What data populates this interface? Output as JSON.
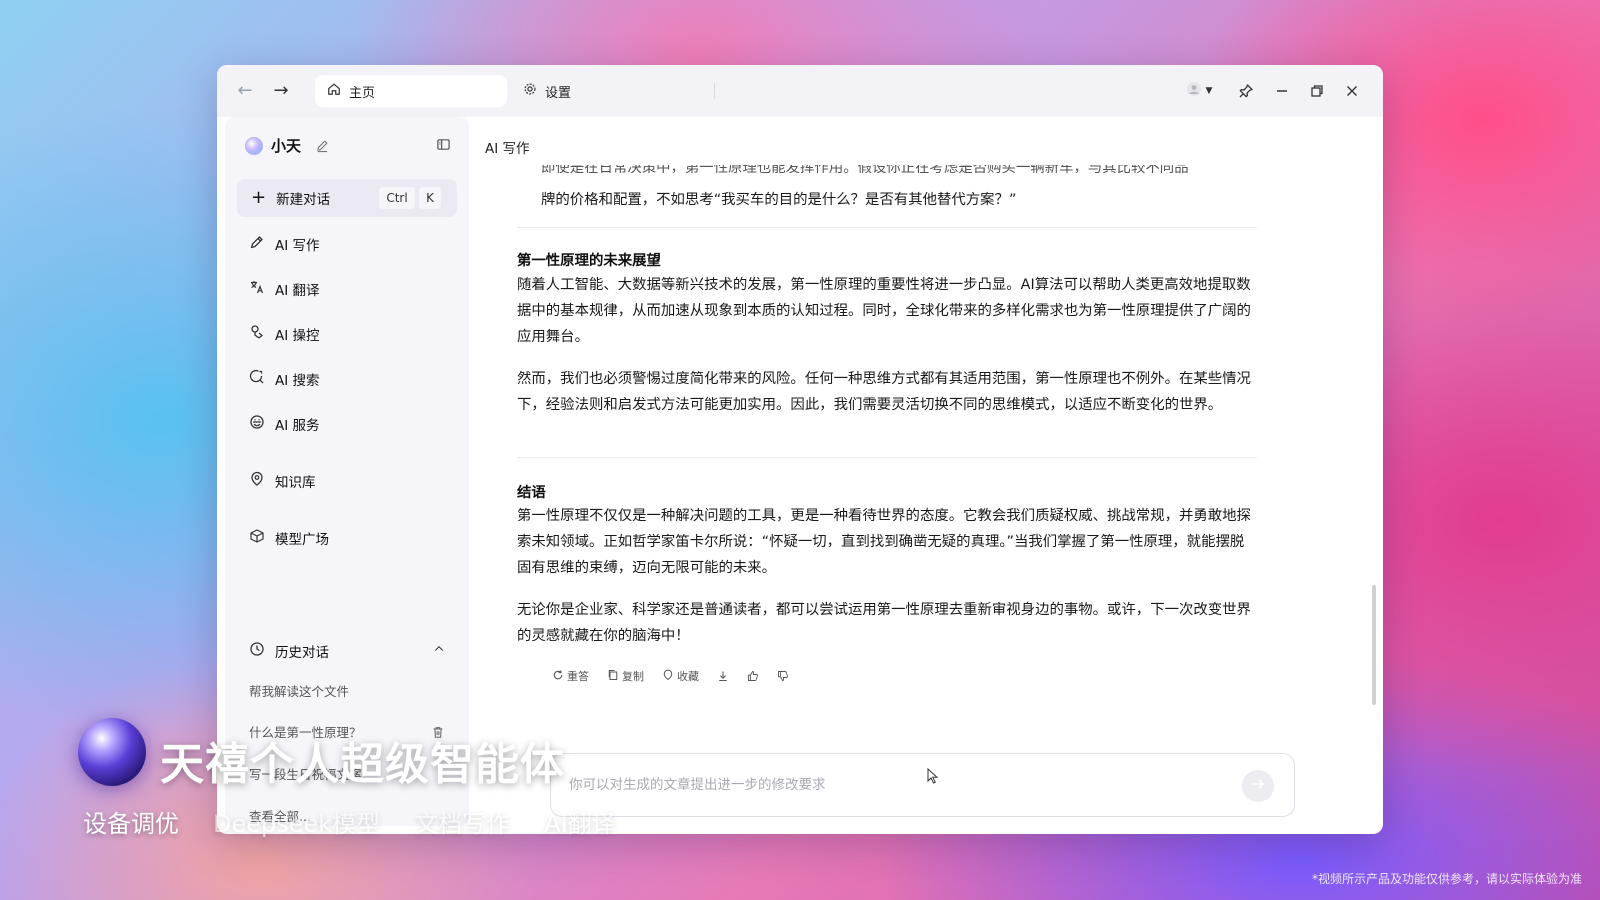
{
  "titlebar": {
    "tab_home": "主页",
    "tab_settings": "设置"
  },
  "sidebar": {
    "assistant_name": "小天",
    "new_chat": {
      "label": "新建对话",
      "shortcut_mod": "Ctrl",
      "shortcut_key": "K"
    },
    "items": [
      {
        "label": "AI 写作",
        "icon": "pen-icon"
      },
      {
        "label": "AI 翻译",
        "icon": "translate-icon"
      },
      {
        "label": "AI 操控",
        "icon": "control-icon"
      },
      {
        "label": "AI 搜索",
        "icon": "search-icon"
      },
      {
        "label": "AI 服务",
        "icon": "service-icon"
      },
      {
        "label": "知识库",
        "icon": "knowledge-icon"
      },
      {
        "label": "模型广场",
        "icon": "cube-icon"
      }
    ],
    "history": {
      "label": "历史对话",
      "items": [
        "帮我解读这个文件",
        "什么是第一性原理？",
        "写一段生日祝福文案"
      ],
      "view_all": "查看全部..."
    }
  },
  "main": {
    "title": "AI 写作",
    "partial_line": "即使是在日常决策中，第一性原理也能发挥作用。假设你正在考虑是否购买一辆新车，与其比较不同品",
    "partial_para_end": "牌的价格和配置，不如思考“我买车的目的是什么？是否有其他替代方案？”",
    "section1_title": "第一性原理的未来展望",
    "section1_p1": "随着人工智能、大数据等新兴技术的发展，第一性原理的重要性将进一步凸显。AI算法可以帮助人类更高效地提取数据中的基本规律，从而加速从现象到本质的认知过程。同时，全球化带来的多样化需求也为第一性原理提供了广阔的应用舞台。",
    "section1_p2": "然而，我们也必须警惕过度简化带来的风险。任何一种思维方式都有其适用范围，第一性原理也不例外。在某些情况下，经验法则和启发式方法可能更加实用。因此，我们需要灵活切换不同的思维模式，以适应不断变化的世界。",
    "section2_title": "结语",
    "section2_p1": "第一性原理不仅仅是一种解决问题的工具，更是一种看待世界的态度。它教会我们质疑权威、挑战常规，并勇敢地探索未知领域。正如哲学家笛卡尔所说：“怀疑一切，直到找到确凿无疑的真理。”当我们掌握了第一性原理，就能摆脱固有思维的束缚，迈向无限可能的未来。",
    "section2_p2": "无论你是企业家、科学家还是普通读者，都可以尝试运用第一性原理去重新审视身边的事物。或许，下一次改变世界的灵感就藏在你的脑海中！",
    "actions": {
      "regenerate": "重答",
      "copy": "复制",
      "favorite": "收藏"
    },
    "input_placeholder": "你可以对生成的文章提出进一步的修改要求"
  },
  "overlay": {
    "title": "天禧个人超级智能体",
    "tags": [
      "设备调优",
      "Deepseek模型",
      "文档写作",
      "AI翻译"
    ],
    "disclaimer": "*视频所示产品及功能仅供参考，请以实际体验为准"
  }
}
